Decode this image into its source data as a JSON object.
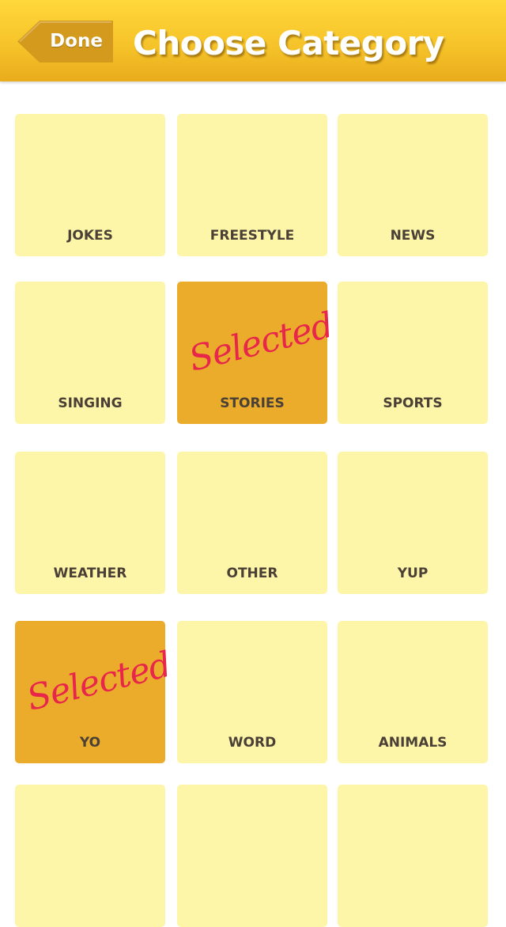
{
  "nav": {
    "back_label": "Done",
    "title": "Choose Category",
    "colors": {
      "bar_top": "#ffd83a",
      "bar_bottom": "#e9ac1c",
      "back_button": "#d39a1e"
    }
  },
  "selected_mark": {
    "text": "Selected",
    "color": "#e8254a"
  },
  "tile_colors": {
    "normal": "#fdf6a9",
    "selected": "#eaac2a"
  },
  "categories": [
    {
      "label": "JOKES",
      "selected": false
    },
    {
      "label": "FREESTYLE",
      "selected": false
    },
    {
      "label": "NEWS",
      "selected": false
    },
    {
      "label": "SINGING",
      "selected": false
    },
    {
      "label": "STORIES",
      "selected": true
    },
    {
      "label": "SPORTS",
      "selected": false
    },
    {
      "label": "WEATHER",
      "selected": false
    },
    {
      "label": "OTHER",
      "selected": false
    },
    {
      "label": "YUP",
      "selected": false
    },
    {
      "label": "YO",
      "selected": true
    },
    {
      "label": "WORD",
      "selected": false
    },
    {
      "label": "ANIMALS",
      "selected": false
    },
    {
      "label": "",
      "selected": false
    },
    {
      "label": "",
      "selected": false
    },
    {
      "label": "",
      "selected": false
    }
  ]
}
